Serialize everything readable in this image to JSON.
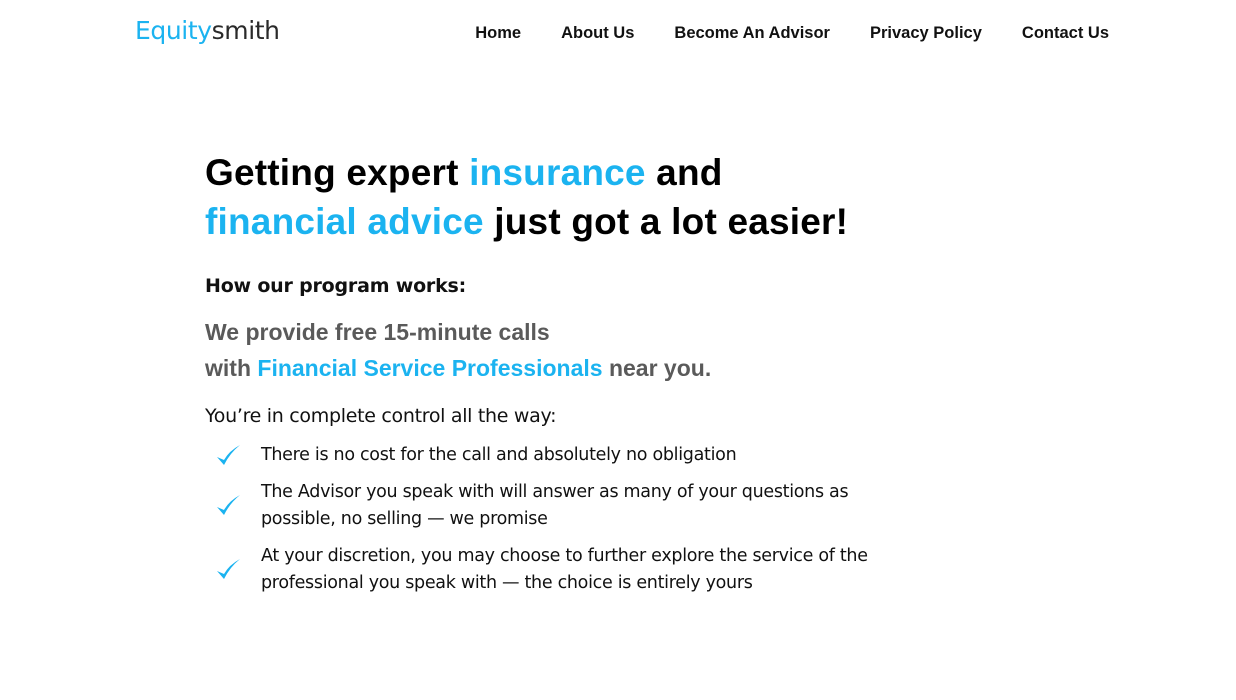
{
  "header": {
    "logo_part1": "Equity",
    "logo_part2": "smith",
    "nav": [
      {
        "label": "Home"
      },
      {
        "label": "About Us"
      },
      {
        "label": "Become An Advisor"
      },
      {
        "label": "Privacy Policy"
      },
      {
        "label": "Contact Us"
      }
    ]
  },
  "hero": {
    "headline_1": "Getting expert ",
    "headline_2": "insurance",
    "headline_3": " and",
    "headline_4": "financial advice",
    "headline_5": " just got a lot easier!",
    "how_title": "How our program works:",
    "provide_1": "We provide free 15-minute calls",
    "provide_2": "with ",
    "provide_3": "Financial Service Professionals",
    "provide_4": " near you.",
    "control_title": "You’re in complete control all the way:",
    "items": [
      {
        "text": "There is no cost for the call and absolutely no obligation"
      },
      {
        "text": "The Advisor you speak with will answer as many of  your questions as possible, no selling — we promise"
      },
      {
        "text": "At your discretion, you may choose to further explore the service of the professional you speak with — the choice is entirely yours"
      }
    ]
  },
  "colors": {
    "accent": "#1bb3f0",
    "text_dark": "#111111",
    "text_gray": "#5a5a5a"
  },
  "icons": {
    "list_check": "checkmark-icon"
  }
}
